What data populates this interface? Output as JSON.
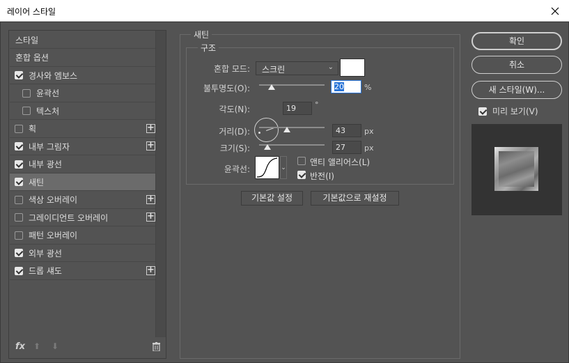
{
  "window": {
    "title": "레이어 스타일"
  },
  "left_list": {
    "items": [
      {
        "label": "스타일",
        "checkbox": false,
        "checked": false,
        "plus": false,
        "sub": false,
        "selected": false
      },
      {
        "label": "혼합 옵션",
        "checkbox": false,
        "checked": false,
        "plus": false,
        "sub": false,
        "selected": false
      },
      {
        "label": "경사와 엠보스",
        "checkbox": true,
        "checked": true,
        "plus": false,
        "sub": false,
        "selected": false
      },
      {
        "label": "윤곽선",
        "checkbox": true,
        "checked": false,
        "plus": false,
        "sub": true,
        "selected": false
      },
      {
        "label": "텍스처",
        "checkbox": true,
        "checked": false,
        "plus": false,
        "sub": true,
        "selected": false
      },
      {
        "label": "획",
        "checkbox": true,
        "checked": false,
        "plus": true,
        "sub": false,
        "selected": false
      },
      {
        "label": "내부 그림자",
        "checkbox": true,
        "checked": true,
        "plus": true,
        "sub": false,
        "selected": false
      },
      {
        "label": "내부 광선",
        "checkbox": true,
        "checked": true,
        "plus": false,
        "sub": false,
        "selected": false
      },
      {
        "label": "새틴",
        "checkbox": true,
        "checked": true,
        "plus": false,
        "sub": false,
        "selected": true
      },
      {
        "label": "색상 오버레이",
        "checkbox": true,
        "checked": false,
        "plus": true,
        "sub": false,
        "selected": false
      },
      {
        "label": "그레이디언트 오버레이",
        "checkbox": true,
        "checked": false,
        "plus": true,
        "sub": false,
        "selected": false
      },
      {
        "label": "패턴 오버레이",
        "checkbox": true,
        "checked": false,
        "plus": false,
        "sub": false,
        "selected": false
      },
      {
        "label": "외부 광선",
        "checkbox": true,
        "checked": true,
        "plus": false,
        "sub": false,
        "selected": false
      },
      {
        "label": "드롭 섀도",
        "checkbox": true,
        "checked": true,
        "plus": true,
        "sub": false,
        "selected": false
      }
    ],
    "footer": {
      "fx": "fx",
      "up": "⬆",
      "down": "⬇",
      "trash": "🗑"
    }
  },
  "satin": {
    "section_title": "새틴",
    "structure_title": "구조",
    "blend_mode_label": "혼합 모드:",
    "blend_mode_value": "스크린",
    "blend_color": "#ffffff",
    "opacity_label": "불투명도(O):",
    "opacity_value": "20",
    "opacity_unit": "%",
    "angle_label": "각도(N):",
    "angle_value": "19",
    "angle_unit": "°",
    "distance_label": "거리(D):",
    "distance_value": "43",
    "distance_unit": "px",
    "size_label": "크기(S):",
    "size_value": "27",
    "size_unit": "px",
    "contour_label": "윤곽선:",
    "anti_alias_label": "앤티 앨리어스(L)",
    "anti_alias_checked": false,
    "invert_label": "반전(I)",
    "invert_checked": true,
    "make_default_label": "기본값 설정",
    "reset_default_label": "기본값으로 재설정"
  },
  "right": {
    "ok_label": "확인",
    "cancel_label": "취소",
    "new_style_label": "새 스타일(W)...",
    "preview_label": "미리 보기(V)",
    "preview_checked": true
  }
}
